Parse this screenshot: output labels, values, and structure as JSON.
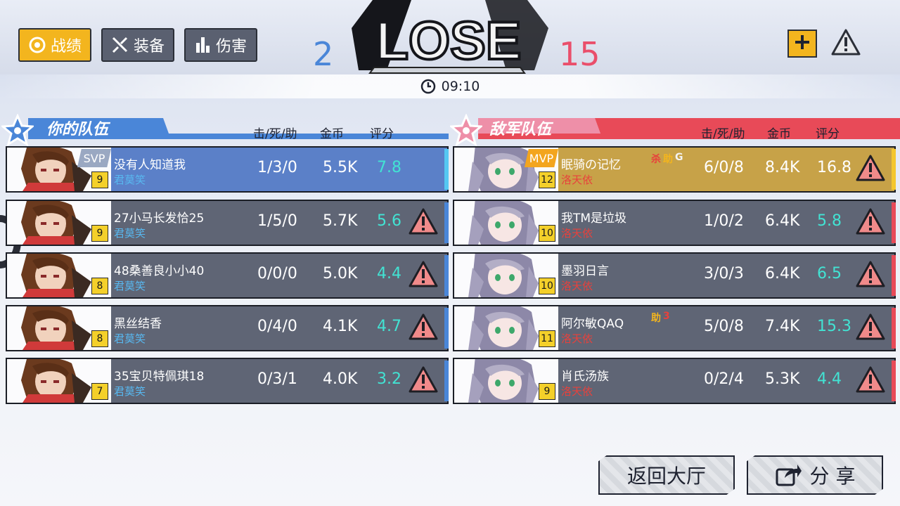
{
  "tabs": [
    {
      "label": "战绩",
      "icon": "ring-icon",
      "active": true
    },
    {
      "label": "装备",
      "icon": "sword-icon",
      "active": false
    },
    {
      "label": "伤害",
      "icon": "bar-chart-icon",
      "active": false
    }
  ],
  "result": {
    "title": "LOSE",
    "score_own": "2",
    "score_enemy": "15"
  },
  "timer": {
    "value": "09:10"
  },
  "own_team": {
    "title": "你的队伍",
    "col_kda": "击/死/助",
    "col_gold": "金币",
    "col_rate": "评分",
    "players": [
      {
        "name": "没有人知道我",
        "guild": "君莫笑",
        "level": "9",
        "badge": "SVP",
        "kda": "1/3/0",
        "gold": "5.5K",
        "rate": "7.8"
      },
      {
        "name": "27小马长发恰25",
        "guild": "君莫笑",
        "level": "9",
        "kda": "1/5/0",
        "gold": "5.7K",
        "rate": "5.6"
      },
      {
        "name": "48桑善良小小40",
        "guild": "君莫笑",
        "level": "8",
        "kda": "0/0/0",
        "gold": "5.0K",
        "rate": "4.4"
      },
      {
        "name": "黑丝结香",
        "guild": "君莫笑",
        "level": "8",
        "kda": "0/4/0",
        "gold": "4.1K",
        "rate": "4.7"
      },
      {
        "name": "35宝贝特佩琪18",
        "guild": "君莫笑",
        "level": "7",
        "kda": "0/3/1",
        "gold": "4.0K",
        "rate": "3.2"
      }
    ]
  },
  "enemy_team": {
    "title": "敌军队伍",
    "col_kda": "击/死/助",
    "col_gold": "金币",
    "col_rate": "评分",
    "players": [
      {
        "name": "眠骑の记忆",
        "guild": "洛天依",
        "level": "12",
        "badge": "MVP",
        "tags": [
          "杀",
          "助",
          "G"
        ],
        "kda": "6/0/8",
        "gold": "8.4K",
        "rate": "16.8"
      },
      {
        "name": "我TM是垃圾",
        "guild": "洛天依",
        "level": "10",
        "kda": "1/0/2",
        "gold": "6.4K",
        "rate": "5.8"
      },
      {
        "name": "墨羽日言",
        "guild": "洛天依",
        "level": "10",
        "kda": "3/0/3",
        "gold": "6.4K",
        "rate": "6.5"
      },
      {
        "name": "阿尔敏QAQ",
        "guild": "洛天依",
        "level": "11",
        "tags": [
          "助",
          "3"
        ],
        "kda": "5/0/8",
        "gold": "7.4K",
        "rate": "15.3"
      },
      {
        "name": "肖氏汤族",
        "guild": "洛天依",
        "level": "9",
        "kda": "0/2/4",
        "gold": "5.3K",
        "rate": "4.4"
      }
    ]
  },
  "buttons": {
    "back": "返回大厅",
    "share": "分 享"
  },
  "colors": {
    "own_accent": "#4a86d8",
    "enemy_accent": "#ea4f6b",
    "rate": "#42e3d3",
    "active_tab": "#f3b51e"
  }
}
